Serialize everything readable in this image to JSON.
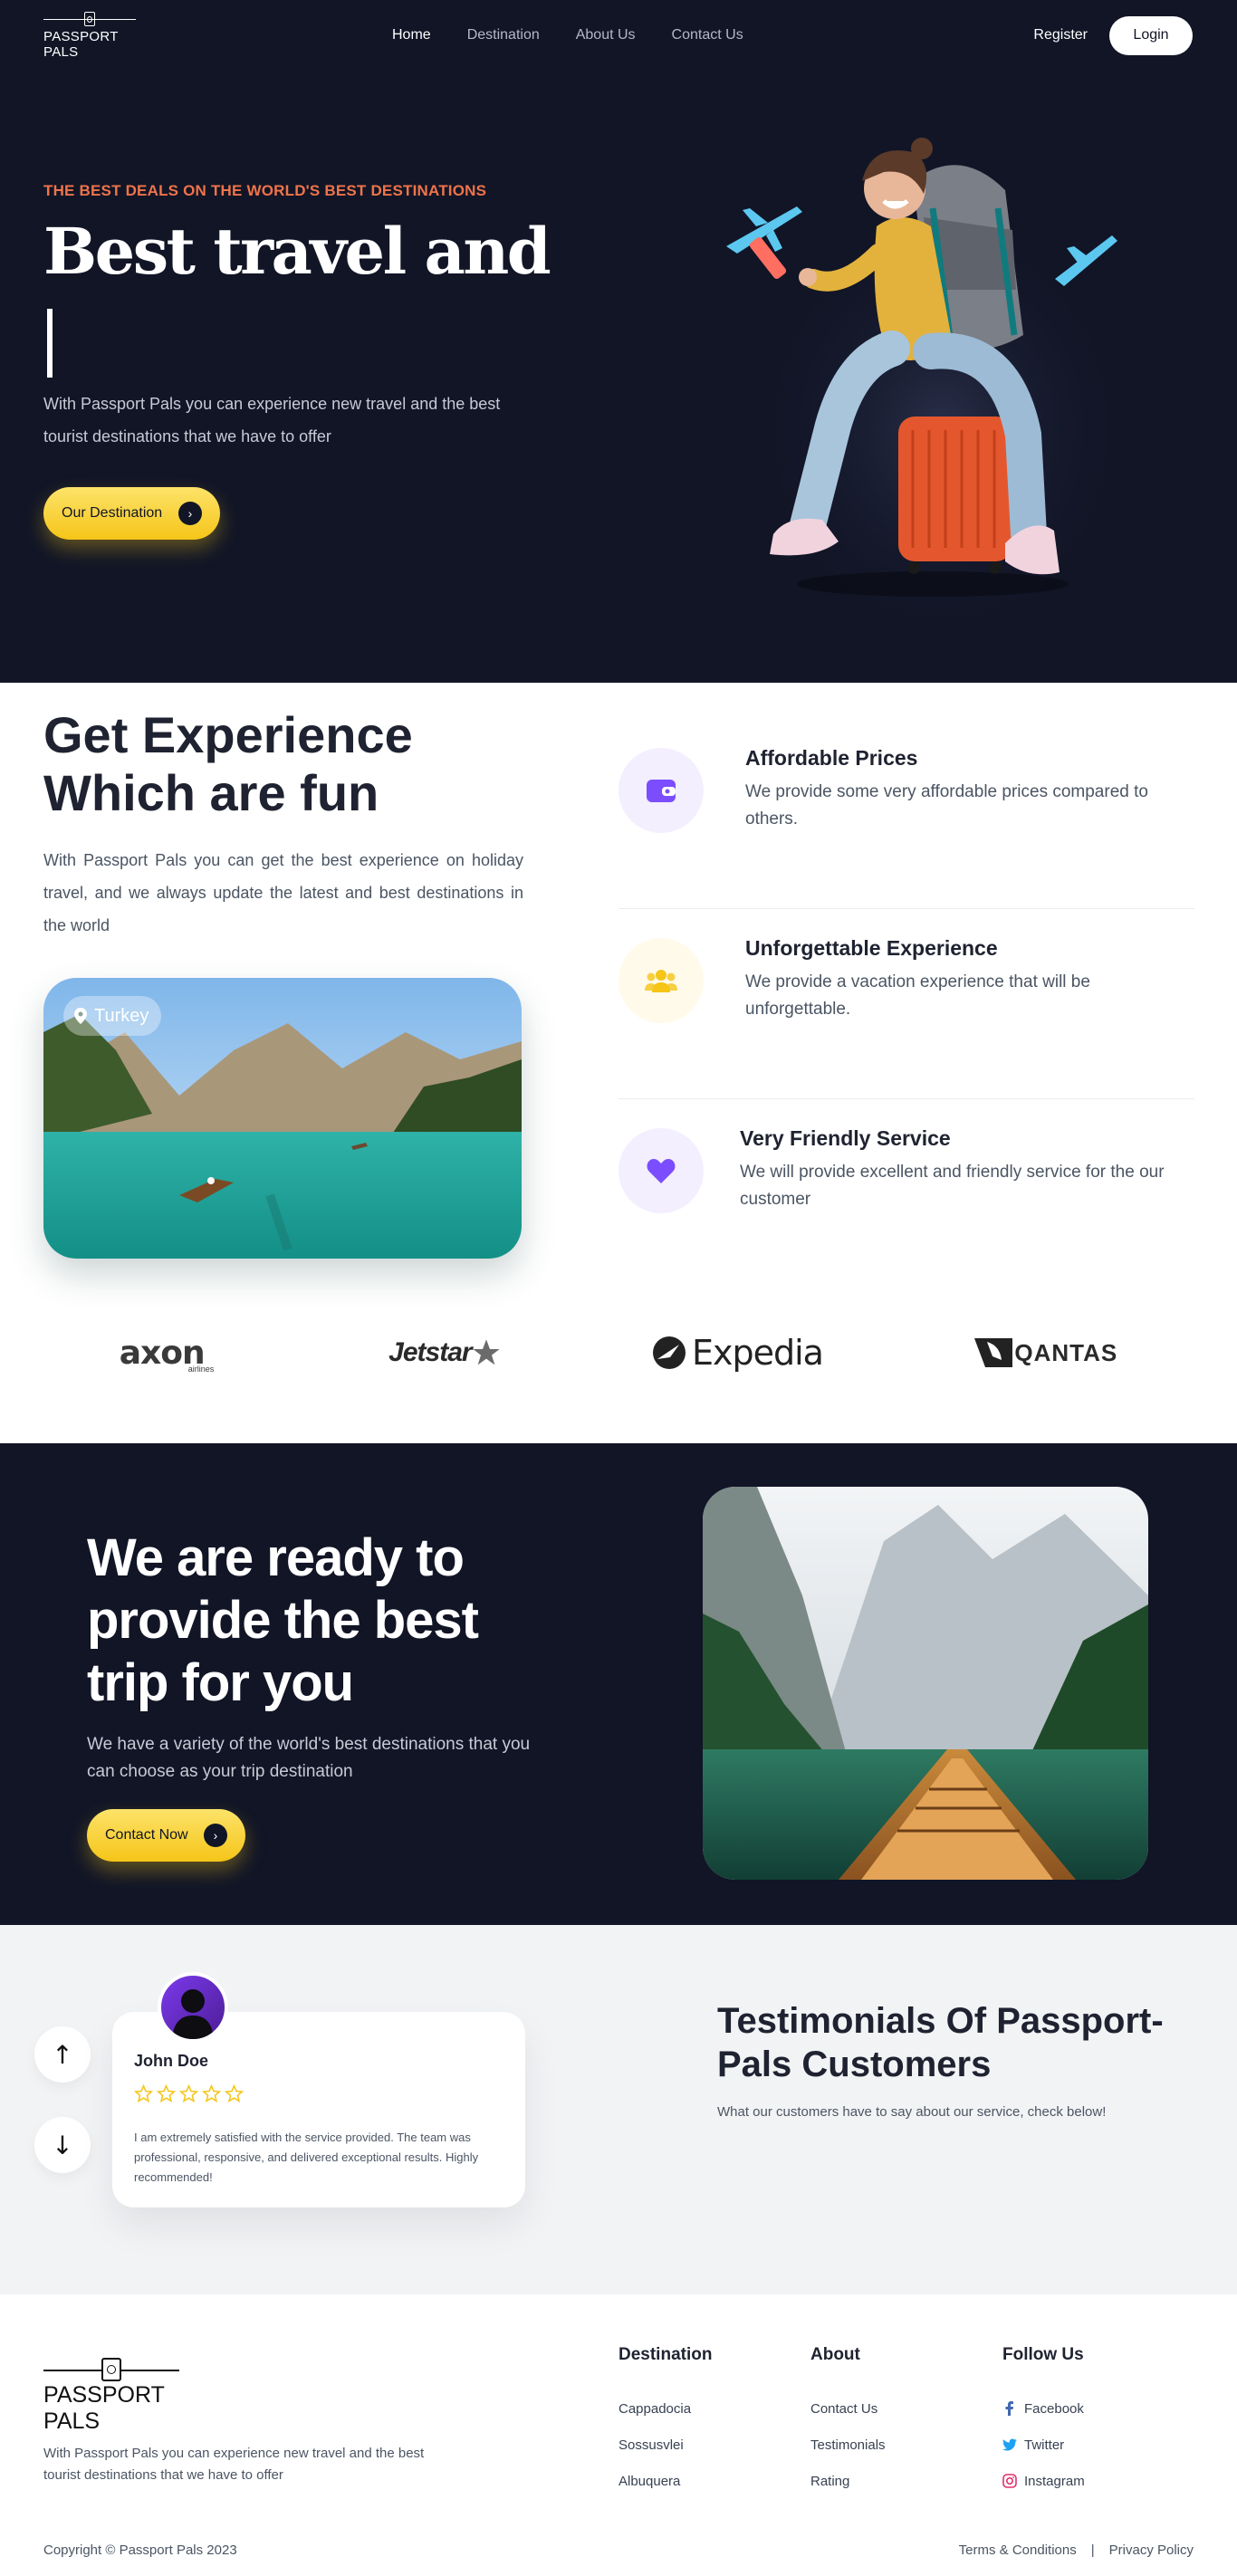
{
  "nav": {
    "brand": "PASSPORT PALS",
    "links": [
      "Home",
      "Destination",
      "About Us",
      "Contact Us"
    ],
    "register": "Register",
    "login": "Login"
  },
  "hero": {
    "kicker": "THE BEST DEALS ON THE WORLD'S BEST DESTINATIONS",
    "title": "Best travel and",
    "description": "With Passport Pals you can experience new travel and the best tourist destinations that we have to offer",
    "cta": "Our Destination"
  },
  "experience": {
    "title": "Get Experience Which are fun",
    "description": "With Passport Pals you can get the best experience on holiday travel, and we always update the latest and best destinations in the world",
    "location": "Turkey",
    "features": [
      {
        "title": "Affordable Prices",
        "description": "We provide some very affordable prices compared to others.",
        "icon": "wallet-icon",
        "bg": "#f3efff",
        "color": "#7c4dff"
      },
      {
        "title": "Unforgettable Experience",
        "description": "We provide a vacation experience that will be unforgettable.",
        "icon": "group-icon",
        "bg": "#fffaea",
        "color": "#f5c518"
      },
      {
        "title": "Very Friendly Service",
        "description": "We will provide excellent and friendly service for the our customer",
        "icon": "heart-icon",
        "bg": "#f3efff",
        "color": "#7c4dff"
      }
    ],
    "partners": [
      "axon",
      "airlines",
      "Jetstar",
      "Expedia",
      "QANTAS"
    ]
  },
  "ready": {
    "title": "We are ready to provide the best trip for you",
    "description": "We have a variety of the world's best destinations that you can choose as your trip destination",
    "cta": "Contact Now"
  },
  "testimonials": {
    "up": "↑",
    "down": "↓",
    "name": "John Doe",
    "rating": 5,
    "text": "I am extremely satisfied with the service provided. The team was professional, responsive, and delivered exceptional results. Highly recommended!",
    "title": "Testimonials Of Passport-Pals Customers",
    "subtitle": "What our customers have to say about our service, check below!"
  },
  "footer": {
    "brand": "PASSPORT PALS",
    "description": "With Passport Pals you can experience new travel and the best tourist destinations that we have to offer",
    "columns": [
      {
        "title": "Destination",
        "links": [
          "Cappadocia",
          "Sossusvlei",
          "Albuquera"
        ]
      },
      {
        "title": "About",
        "links": [
          "Contact Us",
          "Testimonials",
          "Rating"
        ]
      },
      {
        "title": "Follow Us",
        "links": [
          "Facebook",
          "Twitter",
          "Instagram"
        ]
      }
    ],
    "copyright": "Copyright © Passport Pals 2023",
    "terms": "Terms & Conditions",
    "divider": "|",
    "privacy": "Privacy Policy"
  },
  "colors": {
    "navy": "#111526",
    "accent_orange": "#f0734a",
    "accent_yellow": "#f5c518",
    "accent_purple": "#7c4dff",
    "testimonial_bg": "#f2f3f5"
  }
}
